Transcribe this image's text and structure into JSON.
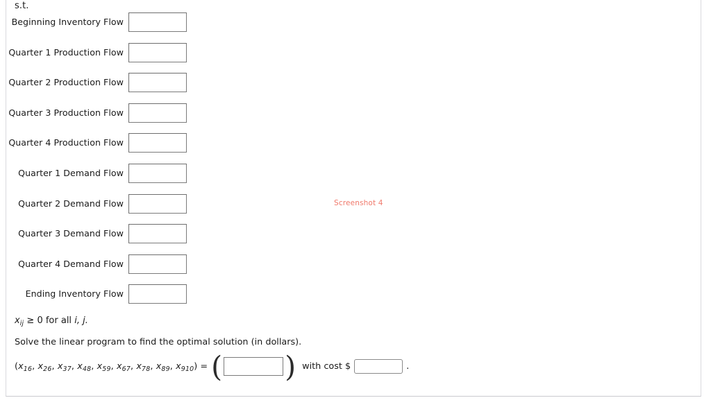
{
  "document": {
    "subject_to_label": "s.t.",
    "nonnegativity": {
      "variable": "x",
      "subscript": "ij",
      "relation": "≥ 0 for all",
      "indices": "i, j."
    },
    "instruction": "Solve the linear program to find the optimal solution (in dollars).",
    "answer": {
      "open_paren": "(",
      "variables": [
        {
          "base": "x",
          "sub": "16"
        },
        {
          "base": "x",
          "sub": "26"
        },
        {
          "base": "x",
          "sub": "37"
        },
        {
          "base": "x",
          "sub": "48"
        },
        {
          "base": "x",
          "sub": "59"
        },
        {
          "base": "x",
          "sub": "67"
        },
        {
          "base": "x",
          "sub": "78"
        },
        {
          "base": "x",
          "sub": "89"
        },
        {
          "base": "x",
          "sub": "910"
        }
      ],
      "close_paren": ")",
      "equals": "=",
      "tuple_value": "",
      "tuple_placeholder": "",
      "with_cost_label": "with cost $",
      "cost_value": "",
      "cost_placeholder": "",
      "period": "."
    }
  },
  "constraints": [
    {
      "label": "Beginning Inventory Flow",
      "value": "",
      "placeholder": ""
    },
    {
      "label": "Quarter 1 Production Flow",
      "value": "",
      "placeholder": ""
    },
    {
      "label": "Quarter 2 Production Flow",
      "value": "",
      "placeholder": ""
    },
    {
      "label": "Quarter 3 Production Flow",
      "value": "",
      "placeholder": ""
    },
    {
      "label": "Quarter 4 Production Flow",
      "value": "",
      "placeholder": ""
    },
    {
      "label": "Quarter 1 Demand Flow",
      "value": "",
      "placeholder": ""
    },
    {
      "label": "Quarter 2 Demand Flow",
      "value": "",
      "placeholder": ""
    },
    {
      "label": "Quarter 3 Demand Flow",
      "value": "",
      "placeholder": ""
    },
    {
      "label": "Quarter 4 Demand Flow",
      "value": "",
      "placeholder": ""
    },
    {
      "label": "Ending Inventory Flow",
      "value": "",
      "placeholder": ""
    }
  ],
  "watermark": {
    "text": "Screenshot 4",
    "color": "#f0796b"
  },
  "colors": {
    "text": "#1a1a1a",
    "input_border": "#7b7b7b",
    "panel_border": "#d9d9dd",
    "background": "#ffffff"
  }
}
